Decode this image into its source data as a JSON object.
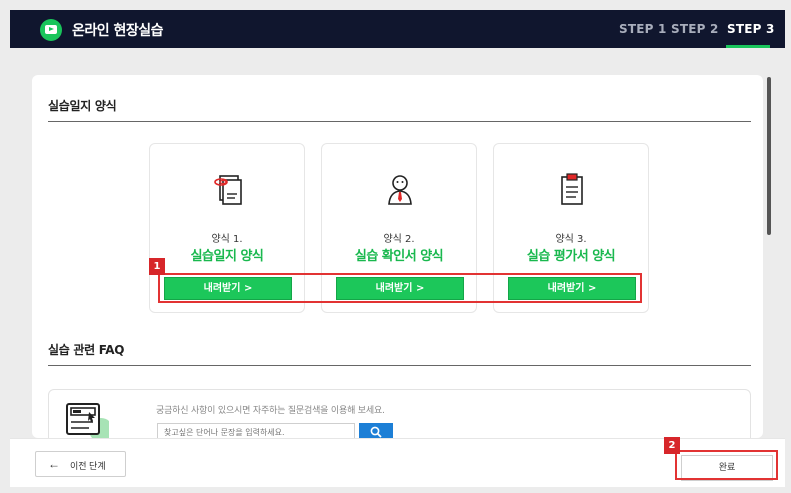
{
  "header": {
    "title": "온라인 현장실습",
    "steps": [
      "STEP 1",
      "STEP 2",
      "STEP 3"
    ],
    "active_step": "STEP 3"
  },
  "forms_section": {
    "title": "실습일지 양식",
    "cards": [
      {
        "sub": "양식 1.",
        "name": "실습일지 양식",
        "button": "내려받기  >",
        "icon": "document-clip-icon"
      },
      {
        "sub": "양식 2.",
        "name": "실습 확인서 양식",
        "button": "내려받기  >",
        "icon": "person-tie-icon"
      },
      {
        "sub": "양식 3.",
        "name": "실습 평가서 양식",
        "button": "내려받기  >",
        "icon": "clipboard-icon"
      }
    ]
  },
  "faq_section": {
    "title": "실습 관련 FAQ",
    "help_text": "궁금하신 사항이 있으시면 자주하는 질문검색을 이용해 보세요.",
    "search_placeholder": "찾고싶은 단어나 문장을 입력하세요."
  },
  "annotations": [
    "1",
    "2"
  ],
  "footer": {
    "prev_label": "이전 단계",
    "done_label": "완료"
  },
  "colors": {
    "header_bg": "#10162e",
    "accent_green": "#1cc75a",
    "annotation_red": "#e23333",
    "search_blue": "#1d7fd6"
  }
}
